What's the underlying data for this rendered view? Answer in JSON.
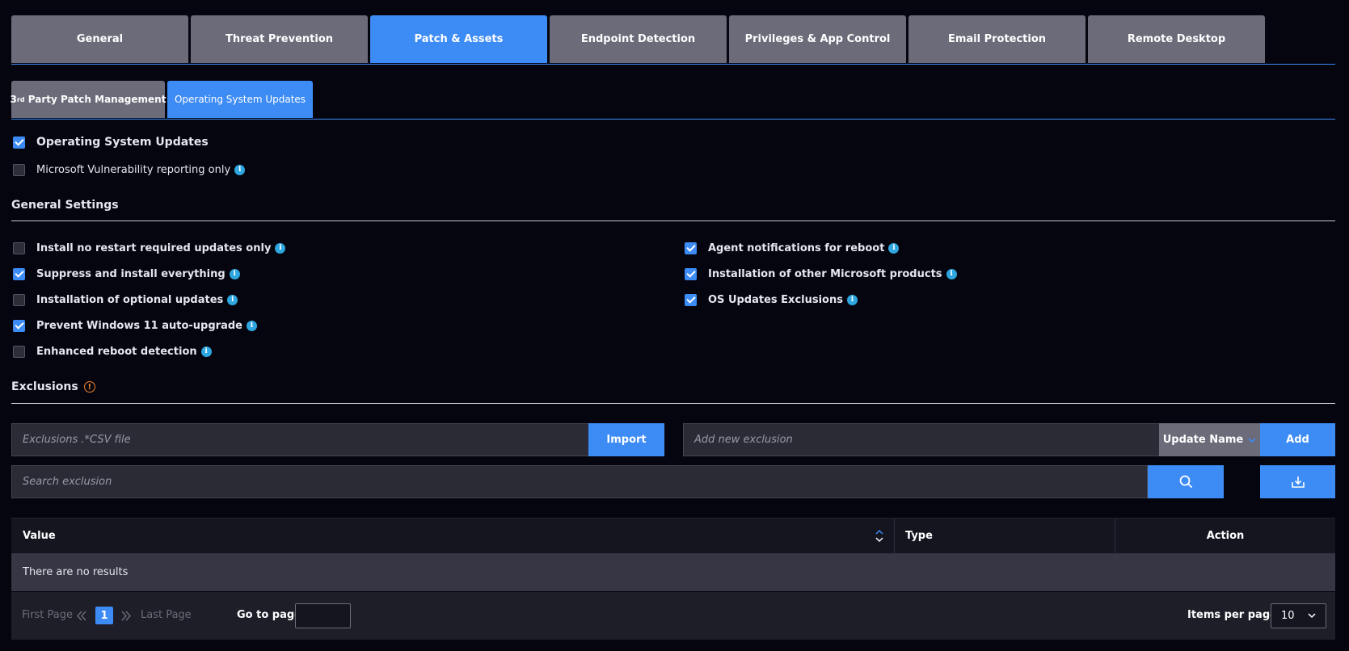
{
  "main_tabs": [
    {
      "label": "General",
      "active": false
    },
    {
      "label": "Threat Prevention",
      "active": false
    },
    {
      "label": "Patch & Assets",
      "active": true
    },
    {
      "label": "Endpoint Detection",
      "active": false
    },
    {
      "label": "Privileges & App Control",
      "active": false
    },
    {
      "label": "Email Protection",
      "active": false
    },
    {
      "label": "Remote Desktop",
      "active": false
    }
  ],
  "sub_tabs": [
    {
      "label_prefix": "3",
      "label_sup": "rd",
      "label_rest": " Party Patch Management",
      "active": false
    },
    {
      "label": "Operating System Updates",
      "active": true
    }
  ],
  "os_updates": {
    "label": "Operating System Updates",
    "checked": true
  },
  "ms_vuln": {
    "label": "Microsoft Vulnerability reporting only",
    "checked": false
  },
  "general_settings": {
    "title": "General Settings",
    "left": [
      {
        "label": "Install no restart required updates only",
        "checked": false
      },
      {
        "label": "Suppress and install everything",
        "checked": true
      },
      {
        "label": "Installation of optional updates",
        "checked": false
      },
      {
        "label": "Prevent Windows 11 auto-upgrade",
        "checked": true
      },
      {
        "label": "Enhanced reboot detection",
        "checked": false
      }
    ],
    "right": [
      {
        "label": "Agent notifications for reboot",
        "checked": true
      },
      {
        "label": "Installation of other Microsoft products",
        "checked": true
      },
      {
        "label": "OS Updates Exclusions",
        "checked": true
      }
    ]
  },
  "exclusions": {
    "title": "Exclusions",
    "csv_placeholder": "Exclusions .*CSV file",
    "import_label": "Import",
    "add_placeholder": "Add new exclusion",
    "type_select": "Update Name",
    "add_label": "Add",
    "search_placeholder": "Search exclusion"
  },
  "table": {
    "columns": [
      "Value",
      "Type",
      "Action"
    ],
    "empty_text": "There are no results"
  },
  "pager": {
    "first": "First Page",
    "last": "Last Page",
    "current_page": "1",
    "goto_label": "Go to page:",
    "items_label": "Items per page:",
    "items_value": "10"
  },
  "colors": {
    "accent": "#3d8bf5",
    "tab_inactive": "#6b6b7a",
    "background": "#05050f",
    "info": "#2ea6e0",
    "warning": "#f0832b"
  }
}
